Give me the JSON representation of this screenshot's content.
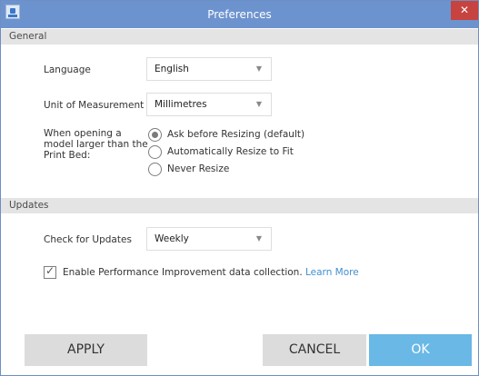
{
  "window": {
    "title": "Preferences",
    "close_glyph": "✕"
  },
  "general": {
    "header": "General",
    "language": {
      "label": "Language",
      "value": "English"
    },
    "unit": {
      "label": "Unit of Measurement",
      "value": "Millimetres"
    },
    "resize": {
      "label_lines": [
        "When opening a",
        "model larger than the",
        "Print Bed:"
      ],
      "options": [
        {
          "label": "Ask before Resizing (default)",
          "checked": true
        },
        {
          "label": "Automatically Resize to Fit",
          "checked": false
        },
        {
          "label": "Never Resize",
          "checked": false
        }
      ]
    }
  },
  "updates": {
    "header": "Updates",
    "check": {
      "label": "Check for Updates",
      "value": "Weekly"
    },
    "perf": {
      "label": "Enable Performance Improvement data collection.",
      "link": "Learn More",
      "checked": true
    }
  },
  "buttons": {
    "apply": "APPLY",
    "cancel": "CANCEL",
    "ok": "OK"
  },
  "icons": {
    "dropdown": "chevron-down-icon",
    "app": "app-icon",
    "close": "close-icon"
  },
  "colors": {
    "titlebar": "#6d93cf",
    "close": "#c7433f",
    "ok": "#6ab8e6",
    "link": "#3f8fd0"
  }
}
